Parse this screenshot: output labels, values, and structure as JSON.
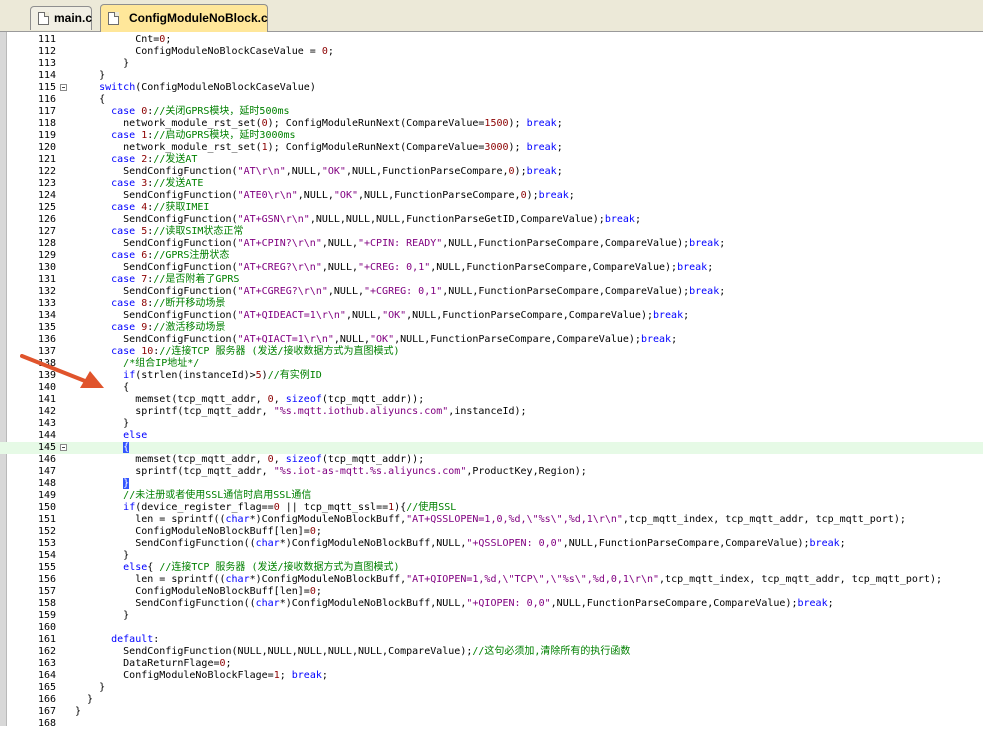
{
  "tabs": [
    {
      "label": "main.c",
      "active": false
    },
    {
      "label": "ConfigModuleNoBlock.c",
      "active": true
    }
  ],
  "colors": {
    "keyword": "#0000ff",
    "comment": "#008000",
    "string": "#800080",
    "number": "#8b0000",
    "arrow": "#e0542c",
    "highlight": "#e6fae6"
  },
  "annotation": {
    "icon": "red-arrow-icon",
    "points_to_line": 137
  },
  "highlighted_line": 145,
  "fold_lines": [
    115,
    145
  ],
  "lines": [
    {
      "n": 111,
      "t": "          Cnt=0;"
    },
    {
      "n": 112,
      "t": "          ConfigModuleNoBlockCaseValue = 0;"
    },
    {
      "n": 113,
      "t": "        }"
    },
    {
      "n": 114,
      "t": "    }"
    },
    {
      "n": 115,
      "t": "    switch(ConfigModuleNoBlockCaseValue)"
    },
    {
      "n": 116,
      "t": "    {"
    },
    {
      "n": 117,
      "t": "      case 0://关闭GPRS模块，延时500ms"
    },
    {
      "n": 118,
      "t": "        network_module_rst_set(0); ConfigModuleRunNext(CompareValue=1500); break;"
    },
    {
      "n": 119,
      "t": "      case 1://启动GPRS模块，延时3000ms"
    },
    {
      "n": 120,
      "t": "        network_module_rst_set(1); ConfigModuleRunNext(CompareValue=3000); break;"
    },
    {
      "n": 121,
      "t": "      case 2://发送AT"
    },
    {
      "n": 122,
      "t": "        SendConfigFunction(\"AT\\r\\n\",NULL,\"OK\",NULL,FunctionParseCompare,0);break;"
    },
    {
      "n": 123,
      "t": "      case 3://发送ATE"
    },
    {
      "n": 124,
      "t": "        SendConfigFunction(\"ATE0\\r\\n\",NULL,\"OK\",NULL,FunctionParseCompare,0);break;"
    },
    {
      "n": 125,
      "t": "      case 4://获取IMEI"
    },
    {
      "n": 126,
      "t": "        SendConfigFunction(\"AT+GSN\\r\\n\",NULL,NULL,NULL,FunctionParseGetID,CompareValue);break;"
    },
    {
      "n": 127,
      "t": "      case 5://读取SIM状态正常"
    },
    {
      "n": 128,
      "t": "        SendConfigFunction(\"AT+CPIN?\\r\\n\",NULL,\"+CPIN: READY\",NULL,FunctionParseCompare,CompareValue);break;"
    },
    {
      "n": 129,
      "t": "      case 6://GPRS注册状态"
    },
    {
      "n": 130,
      "t": "        SendConfigFunction(\"AT+CREG?\\r\\n\",NULL,\"+CREG: 0,1\",NULL,FunctionParseCompare,CompareValue);break;"
    },
    {
      "n": 131,
      "t": "      case 7://是否附着了GPRS"
    },
    {
      "n": 132,
      "t": "        SendConfigFunction(\"AT+CGREG?\\r\\n\",NULL,\"+CGREG: 0,1\",NULL,FunctionParseCompare,CompareValue);break;"
    },
    {
      "n": 133,
      "t": "      case 8://断开移动场景"
    },
    {
      "n": 134,
      "t": "        SendConfigFunction(\"AT+QIDEACT=1\\r\\n\",NULL,\"OK\",NULL,FunctionParseCompare,CompareValue);break;"
    },
    {
      "n": 135,
      "t": "      case 9://激活移动场景"
    },
    {
      "n": 136,
      "t": "        SendConfigFunction(\"AT+QIACT=1\\r\\n\",NULL,\"OK\",NULL,FunctionParseCompare,CompareValue);break;"
    },
    {
      "n": 137,
      "t": "      case 10://连接TCP 服务器 (发送/接收数据方式为直图模式)"
    },
    {
      "n": 138,
      "t": "        /*组合IP地址*/"
    },
    {
      "n": 139,
      "t": "        if(strlen(instanceId)>5)//有实例ID"
    },
    {
      "n": 140,
      "t": "        {"
    },
    {
      "n": 141,
      "t": "          memset(tcp_mqtt_addr, 0, sizeof(tcp_mqtt_addr));"
    },
    {
      "n": 142,
      "t": "          sprintf(tcp_mqtt_addr, \"%s.mqtt.iothub.aliyuncs.com\",instanceId);"
    },
    {
      "n": 143,
      "t": "        }"
    },
    {
      "n": 144,
      "t": "        else"
    },
    {
      "n": 145,
      "t": "        {"
    },
    {
      "n": 146,
      "t": "          memset(tcp_mqtt_addr, 0, sizeof(tcp_mqtt_addr));"
    },
    {
      "n": 147,
      "t": "          sprintf(tcp_mqtt_addr, \"%s.iot-as-mqtt.%s.aliyuncs.com\",ProductKey,Region);"
    },
    {
      "n": 148,
      "t": "        }"
    },
    {
      "n": 149,
      "t": "        //未注册或者使用SSL通信时启用SSL通信"
    },
    {
      "n": 150,
      "t": "        if(device_register_flag==0 || tcp_mqtt_ssl==1){//使用SSL"
    },
    {
      "n": 151,
      "t": "          len = sprintf((char*)ConfigModuleNoBlockBuff,\"AT+QSSLOPEN=1,0,%d,\\\"%s\\\",%d,1\\r\\n\",tcp_mqtt_index, tcp_mqtt_addr, tcp_mqtt_port);"
    },
    {
      "n": 152,
      "t": "          ConfigModuleNoBlockBuff[len]=0;"
    },
    {
      "n": 153,
      "t": "          SendConfigFunction((char*)ConfigModuleNoBlockBuff,NULL,\"+QSSLOPEN: 0,0\",NULL,FunctionParseCompare,CompareValue);break;"
    },
    {
      "n": 154,
      "t": "        }"
    },
    {
      "n": 155,
      "t": "        else{ //连接TCP 服务器 (发送/接收数据方式为直图模式)"
    },
    {
      "n": 156,
      "t": "          len = sprintf((char*)ConfigModuleNoBlockBuff,\"AT+QIOPEN=1,%d,\\\"TCP\\\",\\\"%s\\\",%d,0,1\\r\\n\",tcp_mqtt_index, tcp_mqtt_addr, tcp_mqtt_port);"
    },
    {
      "n": 157,
      "t": "          ConfigModuleNoBlockBuff[len]=0;"
    },
    {
      "n": 158,
      "t": "          SendConfigFunction((char*)ConfigModuleNoBlockBuff,NULL,\"+QIOPEN: 0,0\",NULL,FunctionParseCompare,CompareValue);break;"
    },
    {
      "n": 159,
      "t": "        }"
    },
    {
      "n": 160,
      "t": ""
    },
    {
      "n": 161,
      "t": "      default:"
    },
    {
      "n": 162,
      "t": "        SendConfigFunction(NULL,NULL,NULL,NULL,NULL,CompareValue);//这句必须加,清除所有的执行函数"
    },
    {
      "n": 163,
      "t": "        DataReturnFlage=0;"
    },
    {
      "n": 164,
      "t": "        ConfigModuleNoBlockFlage=1; break;"
    },
    {
      "n": 165,
      "t": "    }"
    },
    {
      "n": 166,
      "t": "  }"
    },
    {
      "n": 167,
      "t": "}"
    },
    {
      "n": 168,
      "t": ""
    }
  ]
}
